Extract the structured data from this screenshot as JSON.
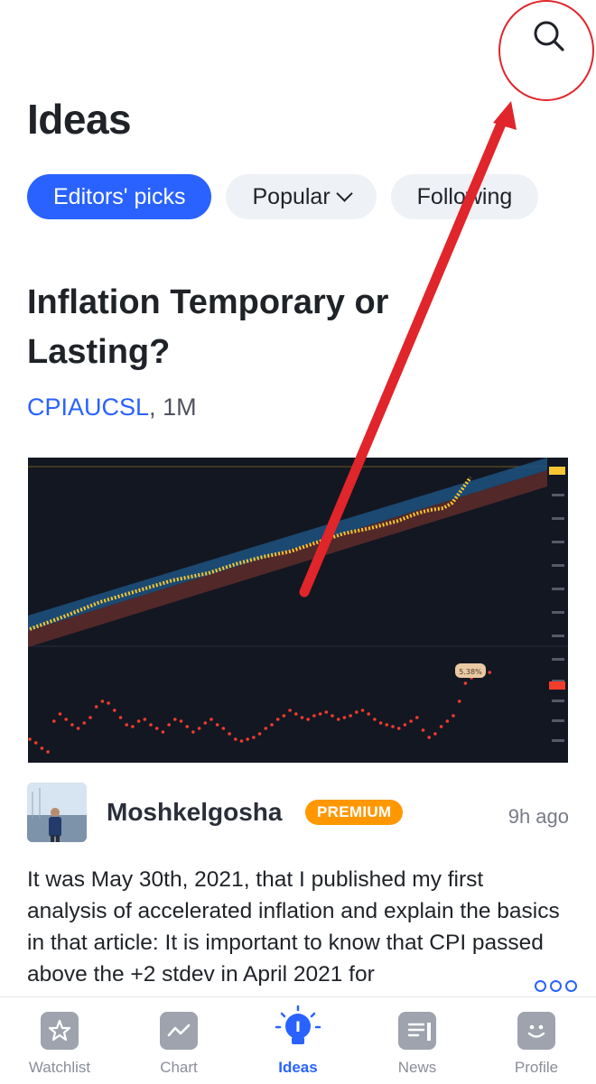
{
  "header": {
    "title": "Ideas",
    "search_icon": "search-icon"
  },
  "tabs": [
    {
      "label": "Editors' picks",
      "active": true
    },
    {
      "label": "Popular",
      "active": false,
      "has_dropdown": true
    },
    {
      "label": "Following",
      "active": false
    }
  ],
  "idea": {
    "title": "Inflation Temporary or Lasting?",
    "symbol": "CPIAUCSL",
    "separator": ", ",
    "timeframe": "1M",
    "author": "Moshkelgosha",
    "badge": "PREMIUM",
    "time_ago": "9h ago",
    "description": "It was May 30th, 2021, that I published my first analysis of accelerated inflation and explain the basics in that article: It is important to know that CPI passed above the +2 stdev in April 2021 for",
    "chart_label": "5.38%"
  },
  "bottom_nav": [
    {
      "label": "Watchlist",
      "icon": "star-icon",
      "active": false
    },
    {
      "label": "Chart",
      "icon": "chart-icon",
      "active": false
    },
    {
      "label": "Ideas",
      "icon": "lightbulb-icon",
      "active": true
    },
    {
      "label": "News",
      "icon": "newspaper-icon",
      "active": false
    },
    {
      "label": "Profile",
      "icon": "smiley-icon",
      "active": false
    }
  ],
  "colors": {
    "accent": "#2962ff",
    "premium": "#ff9800",
    "annotation": "#e0252b",
    "chart_bg": "#131722",
    "price_line": "#f7c631",
    "roc_dots": "#f23c2c"
  }
}
